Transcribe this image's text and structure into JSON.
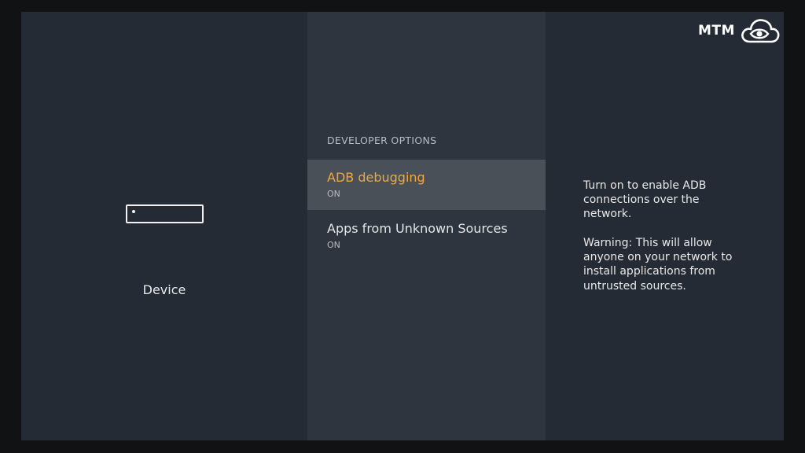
{
  "left_pane": {
    "icon": "streaming-device-icon",
    "label": "Device"
  },
  "middle_pane": {
    "section_title": "DEVELOPER OPTIONS",
    "items": [
      {
        "title": "ADB debugging",
        "value": "ON",
        "selected": true
      },
      {
        "title": "Apps from Unknown Sources",
        "value": "ON",
        "selected": false
      }
    ]
  },
  "right_pane": {
    "description": "Turn on to enable ADB connections over the network.",
    "warning": "Warning: This will allow anyone on your network to install applications from untrusted sources."
  },
  "logo": {
    "text": "MTM",
    "icon": "cloud-eye-icon"
  },
  "colors": {
    "selected_text": "#f0a73a",
    "selected_background": "#4a5058",
    "pane_background": "#252b34",
    "menu_background": "#2e353e"
  }
}
